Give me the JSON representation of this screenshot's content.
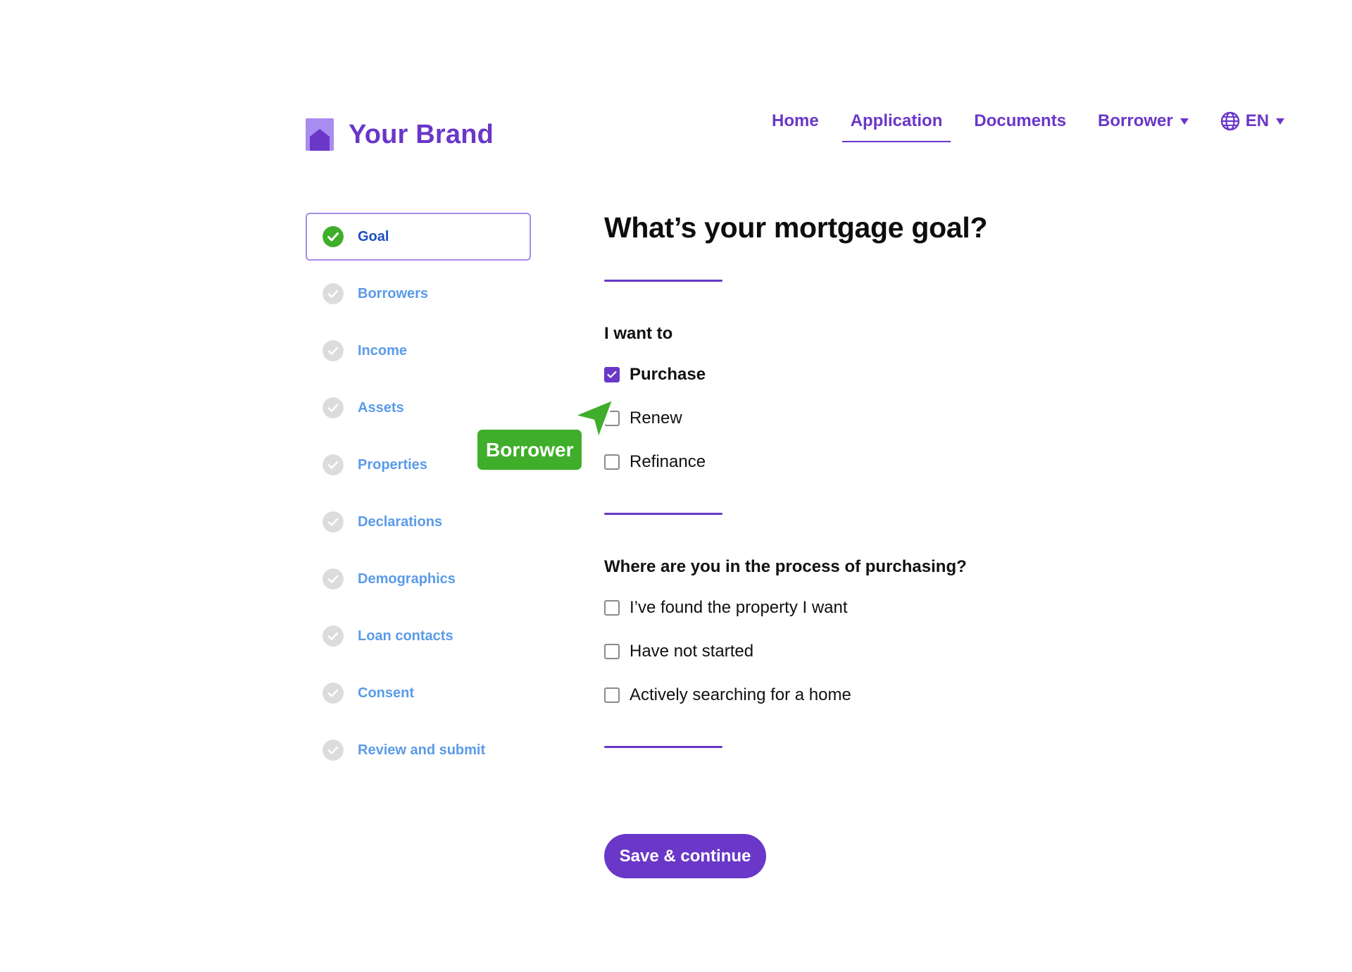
{
  "colors": {
    "brand": "#6a37c8",
    "step_active_text": "#1d4fc2",
    "step_text": "#5a9be8",
    "success": "#3fae2a",
    "step_pending_icon": "#dcdcdc"
  },
  "brand": {
    "name": "Your Brand",
    "logo_icon": "house-icon"
  },
  "nav": {
    "items": [
      {
        "label": "Home",
        "active": false
      },
      {
        "label": "Application",
        "active": true
      },
      {
        "label": "Documents",
        "active": false
      },
      {
        "label": "Borrower",
        "active": false,
        "dropdown": true
      }
    ],
    "language": {
      "label": "EN",
      "icon": "globe-icon"
    }
  },
  "sidebar": {
    "steps": [
      {
        "label": "Goal",
        "status": "complete",
        "active": true
      },
      {
        "label": "Borrowers",
        "status": "pending"
      },
      {
        "label": "Income",
        "status": "pending"
      },
      {
        "label": "Assets",
        "status": "pending"
      },
      {
        "label": "Properties",
        "status": "pending"
      },
      {
        "label": "Declarations",
        "status": "pending"
      },
      {
        "label": "Demographics",
        "status": "pending"
      },
      {
        "label": "Loan contacts",
        "status": "pending"
      },
      {
        "label": "Consent",
        "status": "pending"
      },
      {
        "label": "Review and submit",
        "status": "pending"
      }
    ]
  },
  "main": {
    "title": "What’s your mortgage goal?",
    "goal": {
      "label": "I want to",
      "options": [
        {
          "label": "Purchase",
          "checked": true
        },
        {
          "label": "Renew",
          "checked": false
        },
        {
          "label": "Refinance",
          "checked": false
        }
      ]
    },
    "process": {
      "label": "Where are you in the process of purchasing?",
      "options": [
        {
          "label": "I’ve found the property I want",
          "checked": false
        },
        {
          "label": "Have not started",
          "checked": false
        },
        {
          "label": "Actively searching for a home",
          "checked": false
        }
      ]
    },
    "save_label": "Save & continue"
  },
  "cursor_tag": {
    "label": "Borrower"
  }
}
